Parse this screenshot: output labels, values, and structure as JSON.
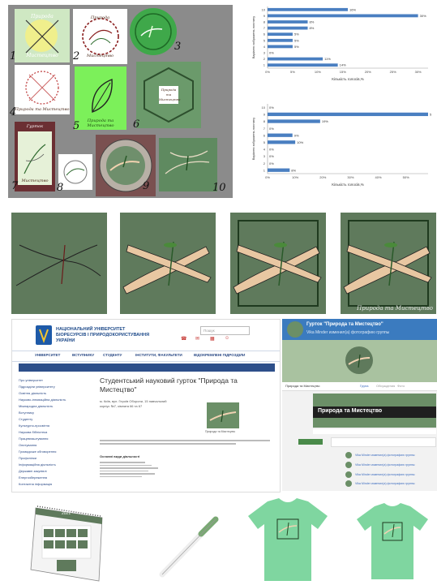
{
  "variants": {
    "numbers": [
      "1",
      "2",
      "3",
      "4",
      "5",
      "6",
      "7",
      "8",
      "9",
      "10"
    ],
    "logo_text_line1": "Природа",
    "logo_text_line2": "та",
    "logo_text_line3": "Мистецтво",
    "logo_text_joined": "Природа та Мистецтво",
    "tile7_header": "Гурток"
  },
  "chart_data": [
    {
      "type": "bar",
      "orientation": "horizontal",
      "categories": [
        "10",
        "9",
        "8",
        "7",
        "6",
        "5",
        "4",
        "3",
        "2",
        "1"
      ],
      "values": [
        16,
        30,
        8,
        8,
        5,
        5,
        5,
        0,
        11,
        14
      ],
      "data_labels": [
        "16%",
        "30%",
        "8%",
        "8%",
        "5%",
        "5%",
        "5%",
        "0%",
        "11%",
        "14%"
      ],
      "xticks": [
        "0%",
        "5%",
        "10%",
        "15%",
        "20%",
        "25%",
        "30%"
      ],
      "xlim": [
        0,
        32
      ],
      "xlabel": "Кількість голосів,%",
      "ylabel": "Варіанти зображень логотипу",
      "color": "#4a7fc1"
    },
    {
      "type": "bar",
      "orientation": "horizontal",
      "categories": [
        "10",
        "9",
        "8",
        "7",
        "6",
        "5",
        "4",
        "3",
        "2",
        "1"
      ],
      "values": [
        0,
        58,
        19,
        0,
        9,
        10,
        0,
        0,
        0,
        8
      ],
      "data_labels": [
        "0%",
        "5",
        "19%",
        "0%",
        "9%",
        "10%",
        "0%",
        "0%",
        "0%",
        "8%"
      ],
      "xticks": [
        "0%",
        "10%",
        "20%",
        "30%",
        "40%",
        "50%"
      ],
      "xlim": [
        0,
        58
      ],
      "xlabel": "Кількість голосів,%",
      "ylabel": "Варіанти зображень логотипу",
      "color": "#4a7fc1"
    }
  ],
  "hands": {
    "caption": "Природа та Мистецтво"
  },
  "site": {
    "university_line1": "НАЦІОНАЛЬНИЙ УНІВЕРСИТЕТ",
    "university_line2": "БІОРЕСУРСІВ І ПРИРОДОКОРИСТУВАННЯ",
    "university_line3": "УКРАЇНИ",
    "search_placeholder": "Пошук",
    "nav": [
      "УНІВЕРСИТЕТ",
      "ВСТУПНИКУ",
      "СТУДЕНТУ",
      "ІНСТИТУТИ, ФАКУЛЬТЕТИ",
      "ВІДОКРЕМЛЕНІ ПІДРОЗДІЛИ"
    ],
    "sidebar": [
      "Про університет",
      "Підрозділи університету",
      "Освітня діяльність",
      "Науково-інноваційна діяльність",
      "Міжнародна діяльність",
      "Вступнику",
      "Студенту",
      "Культурно-просвітня",
      "Наукова бібліотека",
      "Працевлаштування",
      "Опитування",
      "Громадське обговорення",
      "Профспілки",
      "Інформаційна діяльність",
      "Державні закупівлі",
      "Енергозбереження",
      "Контактна інформація"
    ],
    "page_title_line1": "Студентський науковий гурток \"Природа та",
    "page_title_line2": "Мистецтво\"",
    "body_line1": "м. Київ, вул. Героїв Оборони, 15 навчальний",
    "body_line2": "корпус №7, кімната 66 та 67",
    "image_caption": "Природа та Мистецтво",
    "section_title": "Основні види діяльності"
  },
  "social": {
    "group_title": "Гурток \"Природа та Мистецтво\"",
    "update_text": "Vika Minder изменил(а) фотографию группы",
    "group_name": "Природа та Мистецтво",
    "left_tab": "Природа та Мистецтво",
    "tabs": [
      "Група",
      "Обсуждения",
      "Фото"
    ],
    "posts": [
      "Vika Minder изменил(а) фотографию группы",
      "Vika Minder изменил(а) фотографию группы",
      "Vika Minder изменил(а) фотографию группы",
      "Vika Minder изменил(а) фотографию группы"
    ]
  },
  "merch": {
    "calendar_year": "2021"
  },
  "colors": {
    "green_dark": "#5f7a5c",
    "bright_green": "#7cf05a",
    "mint_shirt": "#7fd6a0",
    "bar_blue": "#4a7fc1",
    "maroon": "#6b2f33"
  }
}
